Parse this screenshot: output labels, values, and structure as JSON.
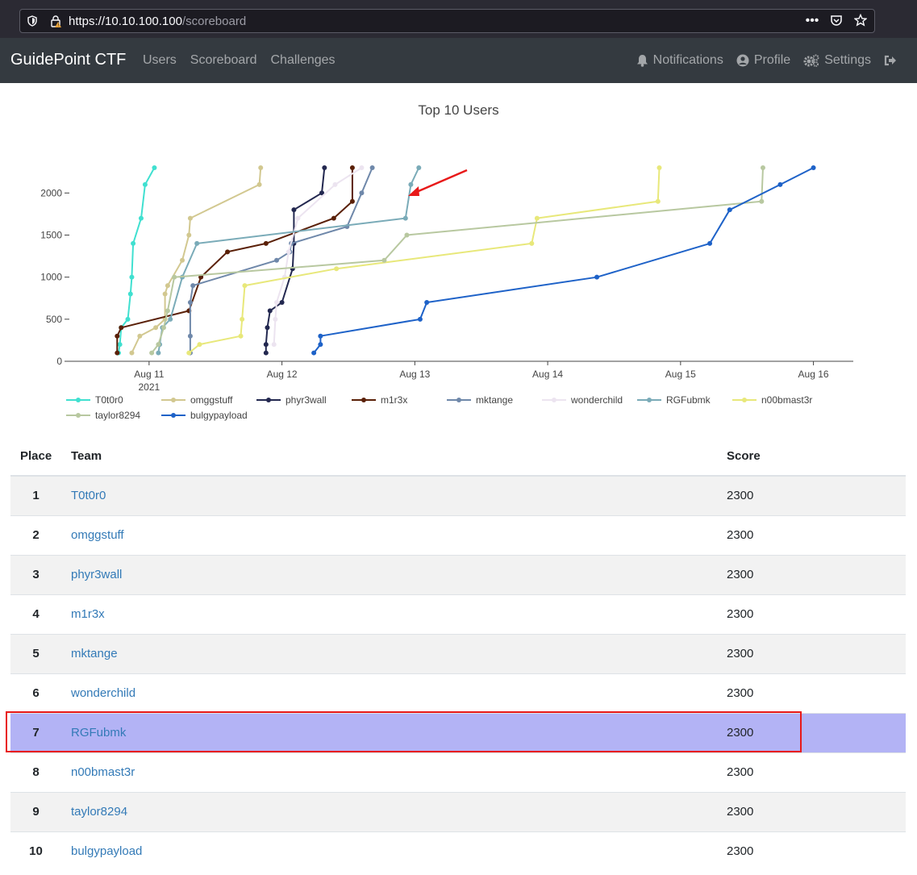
{
  "browser": {
    "url_host": "https://10.10.100.100",
    "url_path": "/scoreboard"
  },
  "navbar": {
    "brand": "GuidePoint CTF",
    "links": [
      "Users",
      "Scoreboard",
      "Challenges"
    ],
    "notifications": "Notifications",
    "profile": "Profile",
    "settings": "Settings"
  },
  "table": {
    "headers": {
      "place": "Place",
      "team": "Team",
      "score": "Score"
    },
    "rows": [
      {
        "place": "1",
        "team": "T0t0r0",
        "score": "2300"
      },
      {
        "place": "2",
        "team": "omggstuff",
        "score": "2300"
      },
      {
        "place": "3",
        "team": "phyr3wall",
        "score": "2300"
      },
      {
        "place": "4",
        "team": "m1r3x",
        "score": "2300"
      },
      {
        "place": "5",
        "team": "mktange",
        "score": "2300"
      },
      {
        "place": "6",
        "team": "wonderchild",
        "score": "2300"
      },
      {
        "place": "7",
        "team": "RGFubmk",
        "score": "2300"
      },
      {
        "place": "8",
        "team": "n00bmast3r",
        "score": "2300"
      },
      {
        "place": "9",
        "team": "taylor8294",
        "score": "2300"
      },
      {
        "place": "10",
        "team": "bulgypayload",
        "score": "2300"
      }
    ],
    "highlighted_place": "7"
  },
  "chart_data": {
    "type": "line",
    "title": "Top 10 Users",
    "xlabel": "",
    "ylabel": "",
    "x_unit": "days (Aug 2021)",
    "xlim": [
      10.4,
      16.3
    ],
    "ylim": [
      0,
      2300
    ],
    "yticks": [
      0,
      500,
      1000,
      1500,
      2000
    ],
    "xticks": [
      {
        "value": 11,
        "label": "Aug 11",
        "sub": "2021"
      },
      {
        "value": 12,
        "label": "Aug 12",
        "sub": ""
      },
      {
        "value": 13,
        "label": "Aug 13",
        "sub": ""
      },
      {
        "value": 14,
        "label": "Aug 14",
        "sub": ""
      },
      {
        "value": 15,
        "label": "Aug 15",
        "sub": ""
      },
      {
        "value": 16,
        "label": "Aug 16",
        "sub": ""
      }
    ],
    "legend_position": "bottom",
    "series": [
      {
        "name": "T0t0r0",
        "color": "#40e0d0",
        "points": [
          [
            10.77,
            100
          ],
          [
            10.78,
            200
          ],
          [
            10.79,
            400
          ],
          [
            10.84,
            500
          ],
          [
            10.86,
            800
          ],
          [
            10.87,
            1000
          ],
          [
            10.88,
            1400
          ],
          [
            10.94,
            1700
          ],
          [
            10.97,
            2100
          ],
          [
            11.04,
            2300
          ]
        ]
      },
      {
        "name": "omggstuff",
        "color": "#d2c890",
        "points": [
          [
            10.87,
            100
          ],
          [
            10.93,
            300
          ],
          [
            11.05,
            400
          ],
          [
            11.12,
            500
          ],
          [
            11.12,
            800
          ],
          [
            11.14,
            900
          ],
          [
            11.25,
            1200
          ],
          [
            11.3,
            1500
          ],
          [
            11.31,
            1700
          ],
          [
            11.83,
            2100
          ],
          [
            11.84,
            2300
          ]
        ]
      },
      {
        "name": "phyr3wall",
        "color": "#232850",
        "points": [
          [
            11.88,
            100
          ],
          [
            11.88,
            200
          ],
          [
            11.89,
            400
          ],
          [
            11.91,
            600
          ],
          [
            12.0,
            700
          ],
          [
            12.08,
            1100
          ],
          [
            12.09,
            1400
          ],
          [
            12.09,
            1800
          ],
          [
            12.3,
            2000
          ],
          [
            12.32,
            2300
          ]
        ]
      },
      {
        "name": "m1r3x",
        "color": "#5a2008",
        "points": [
          [
            10.76,
            100
          ],
          [
            10.76,
            300
          ],
          [
            10.79,
            400
          ],
          [
            11.3,
            600
          ],
          [
            11.39,
            1000
          ],
          [
            11.59,
            1300
          ],
          [
            11.88,
            1400
          ],
          [
            12.39,
            1700
          ],
          [
            12.53,
            1900
          ],
          [
            12.53,
            2300
          ]
        ]
      },
      {
        "name": "mktange",
        "color": "#6f88aa",
        "points": [
          [
            11.31,
            100
          ],
          [
            11.31,
            300
          ],
          [
            11.31,
            700
          ],
          [
            11.33,
            900
          ],
          [
            11.96,
            1200
          ],
          [
            12.06,
            1300
          ],
          [
            12.07,
            1400
          ],
          [
            12.49,
            1600
          ],
          [
            12.6,
            2000
          ],
          [
            12.68,
            2300
          ]
        ]
      },
      {
        "name": "wonderchild",
        "color": "#ece4f0",
        "points": [
          [
            11.94,
            200
          ],
          [
            11.95,
            500
          ],
          [
            11.96,
            700
          ],
          [
            12.02,
            1000
          ],
          [
            12.05,
            1300
          ],
          [
            12.12,
            1700
          ],
          [
            12.4,
            2100
          ],
          [
            12.6,
            2300
          ]
        ]
      },
      {
        "name": "RGFubmk",
        "color": "#7aabb8",
        "points": [
          [
            11.07,
            100
          ],
          [
            11.08,
            200
          ],
          [
            11.1,
            400
          ],
          [
            11.16,
            500
          ],
          [
            11.25,
            1000
          ],
          [
            11.36,
            1400
          ],
          [
            12.93,
            1700
          ],
          [
            12.97,
            2100
          ],
          [
            13.03,
            2300
          ]
        ]
      },
      {
        "name": "n00bmast3r",
        "color": "#e8e87a",
        "points": [
          [
            11.3,
            100
          ],
          [
            11.38,
            200
          ],
          [
            11.69,
            300
          ],
          [
            11.7,
            500
          ],
          [
            11.72,
            900
          ],
          [
            12.41,
            1100
          ],
          [
            13.88,
            1400
          ],
          [
            13.92,
            1700
          ],
          [
            14.83,
            1900
          ],
          [
            14.84,
            2300
          ]
        ]
      },
      {
        "name": "taylor8294",
        "color": "#b8c8a0",
        "points": [
          [
            11.02,
            100
          ],
          [
            11.07,
            200
          ],
          [
            11.11,
            400
          ],
          [
            11.14,
            600
          ],
          [
            11.19,
            1000
          ],
          [
            12.77,
            1200
          ],
          [
            12.94,
            1500
          ],
          [
            15.61,
            1900
          ],
          [
            15.62,
            2300
          ]
        ]
      },
      {
        "name": "bulgypayload",
        "color": "#1e62c8",
        "points": [
          [
            12.24,
            100
          ],
          [
            12.29,
            200
          ],
          [
            12.29,
            300
          ],
          [
            13.04,
            500
          ],
          [
            13.09,
            700
          ],
          [
            14.37,
            1000
          ],
          [
            15.22,
            1400
          ],
          [
            15.37,
            1800
          ],
          [
            15.75,
            2100
          ],
          [
            16.0,
            2300
          ]
        ]
      }
    ]
  }
}
